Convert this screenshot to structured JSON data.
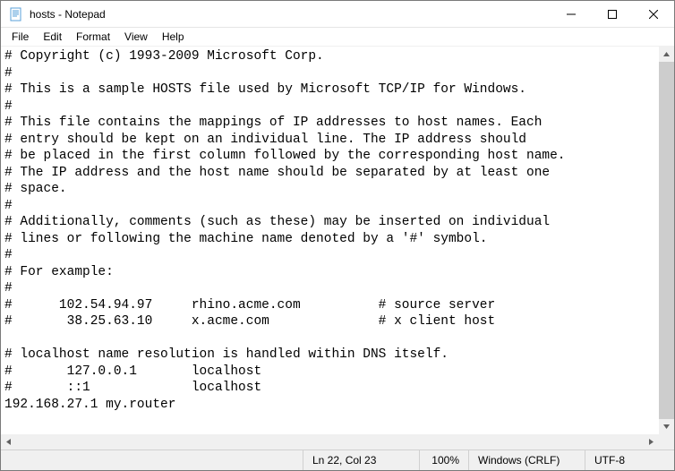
{
  "window": {
    "title": "hosts - Notepad"
  },
  "menubar": {
    "file": "File",
    "edit": "Edit",
    "format": "Format",
    "view": "View",
    "help": "Help"
  },
  "content": "# Copyright (c) 1993-2009 Microsoft Corp.\n#\n# This is a sample HOSTS file used by Microsoft TCP/IP for Windows.\n#\n# This file contains the mappings of IP addresses to host names. Each\n# entry should be kept on an individual line. The IP address should\n# be placed in the first column followed by the corresponding host name.\n# The IP address and the host name should be separated by at least one\n# space.\n#\n# Additionally, comments (such as these) may be inserted on individual\n# lines or following the machine name denoted by a '#' symbol.\n#\n# For example:\n#\n#      102.54.94.97     rhino.acme.com          # source server\n#       38.25.63.10     x.acme.com              # x client host\n\n# localhost name resolution is handled within DNS itself.\n#       127.0.0.1       localhost\n#       ::1             localhost\n192.168.27.1 my.router",
  "statusbar": {
    "position": "Ln 22, Col 23",
    "zoom": "100%",
    "lineending": "Windows (CRLF)",
    "encoding": "UTF-8"
  }
}
